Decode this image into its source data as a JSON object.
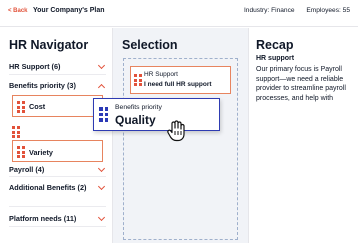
{
  "header": {
    "back_label": "< Back",
    "title": "Your Company's Plan",
    "industry": "Industry: Finance",
    "employees": "Employees: 55"
  },
  "nav": {
    "title": "HR Navigator",
    "items": [
      {
        "label": "HR Support  (6)",
        "expanded": false
      },
      {
        "label": "Benefits priority  (3)",
        "expanded": true
      },
      {
        "label": "Payroll  (4)",
        "expanded": false
      },
      {
        "label": "Additional Benefits (2)",
        "expanded": false
      },
      {
        "label": "Platform needs (11)",
        "expanded": false
      }
    ],
    "options": [
      "Cost",
      "Variety"
    ]
  },
  "selection": {
    "title": "Selection",
    "cards": [
      {
        "category": "HR Support",
        "value": "I need full HR support"
      }
    ],
    "dragging": {
      "category": "Benefits priority",
      "value": "Quality"
    }
  },
  "recap": {
    "title": "Recap",
    "subtitle": "HR support",
    "body": "Our primary focus is Payroll support—we need a reliable provider to streamline payroll processes, and help with"
  },
  "colors": {
    "accent": "#e2523a",
    "drag_border": "#2e3bb2",
    "selection_bg": "#f1f3f7"
  }
}
